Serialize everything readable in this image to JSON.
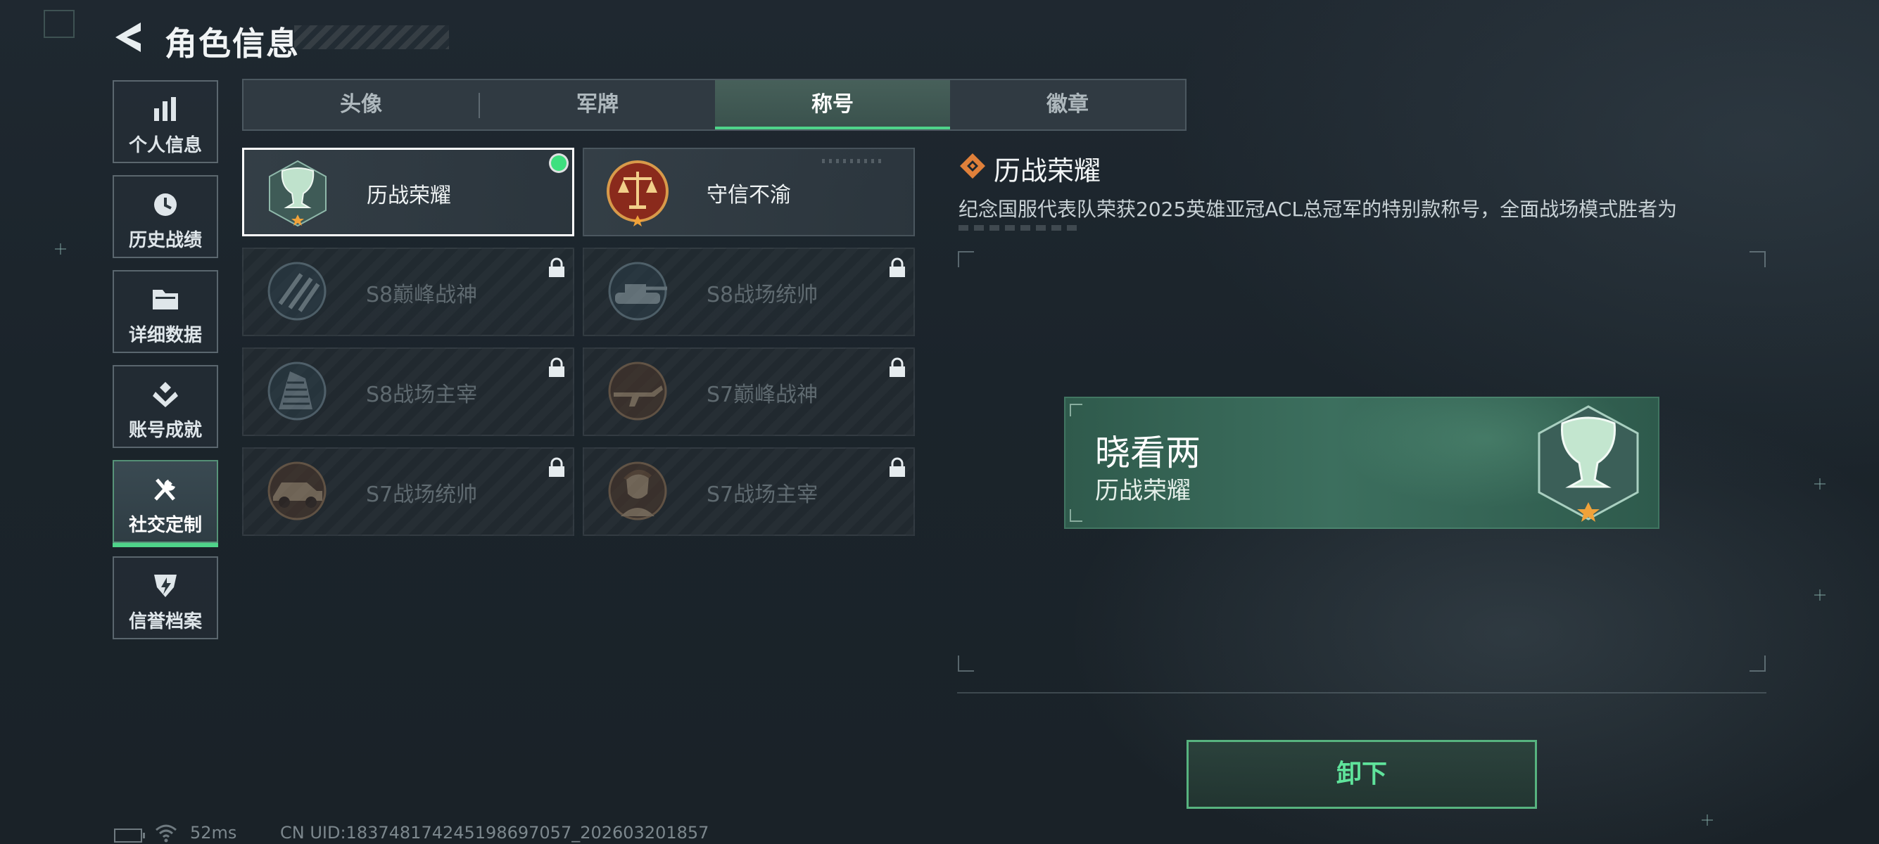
{
  "header": {
    "title": "角色信息"
  },
  "sidebar": {
    "items": [
      {
        "label": "个人信息",
        "icon": "bar-chart-icon"
      },
      {
        "label": "历史战绩",
        "icon": "clock-icon"
      },
      {
        "label": "详细数据",
        "icon": "folder-icon"
      },
      {
        "label": "账号成就",
        "icon": "achievement-icon"
      },
      {
        "label": "社交定制",
        "icon": "tools-icon",
        "active": true
      },
      {
        "label": "信誉档案",
        "icon": "shield-icon"
      }
    ]
  },
  "tabs": [
    {
      "label": "头像"
    },
    {
      "label": "军牌"
    },
    {
      "label": "称号",
      "active": true
    },
    {
      "label": "徽章"
    }
  ],
  "titles": [
    {
      "label": "历战荣耀",
      "emblem": "trophy-emblem-icon",
      "state": "equipped"
    },
    {
      "label": "守信不渝",
      "emblem": "scales-emblem-icon",
      "state": "unlocked"
    },
    {
      "label": "S8巅峰战神",
      "emblem": "slash-emblem-icon",
      "state": "locked"
    },
    {
      "label": "S8战场统帅",
      "emblem": "tank-emblem-icon",
      "state": "locked"
    },
    {
      "label": "S8战场主宰",
      "emblem": "building-emblem-icon",
      "state": "locked"
    },
    {
      "label": "S7巅峰战神",
      "emblem": "rifle-emblem-icon",
      "state": "locked"
    },
    {
      "label": "S7战场统帅",
      "emblem": "vehicle-emblem-icon",
      "state": "locked"
    },
    {
      "label": "S7战场主宰",
      "emblem": "soldier-emblem-icon",
      "state": "locked"
    }
  ],
  "detail": {
    "title": "历战荣耀",
    "description": "纪念国服代表队荣获2025英雄亚冠ACL总冠军的特别款称号，全面战场模式胜者为"
  },
  "preview": {
    "player_name": "晓看两",
    "title": "历战荣耀"
  },
  "actions": {
    "unequip_label": "卸下"
  },
  "status": {
    "ping": "52ms",
    "uid": "CN UID:183748174245198697057_202603201857"
  },
  "colors": {
    "accent_green": "#4fd48a",
    "equipped_dot": "#3ee07f",
    "banner_green": "#3c6f5e",
    "icon_orange": "#e0803a"
  }
}
